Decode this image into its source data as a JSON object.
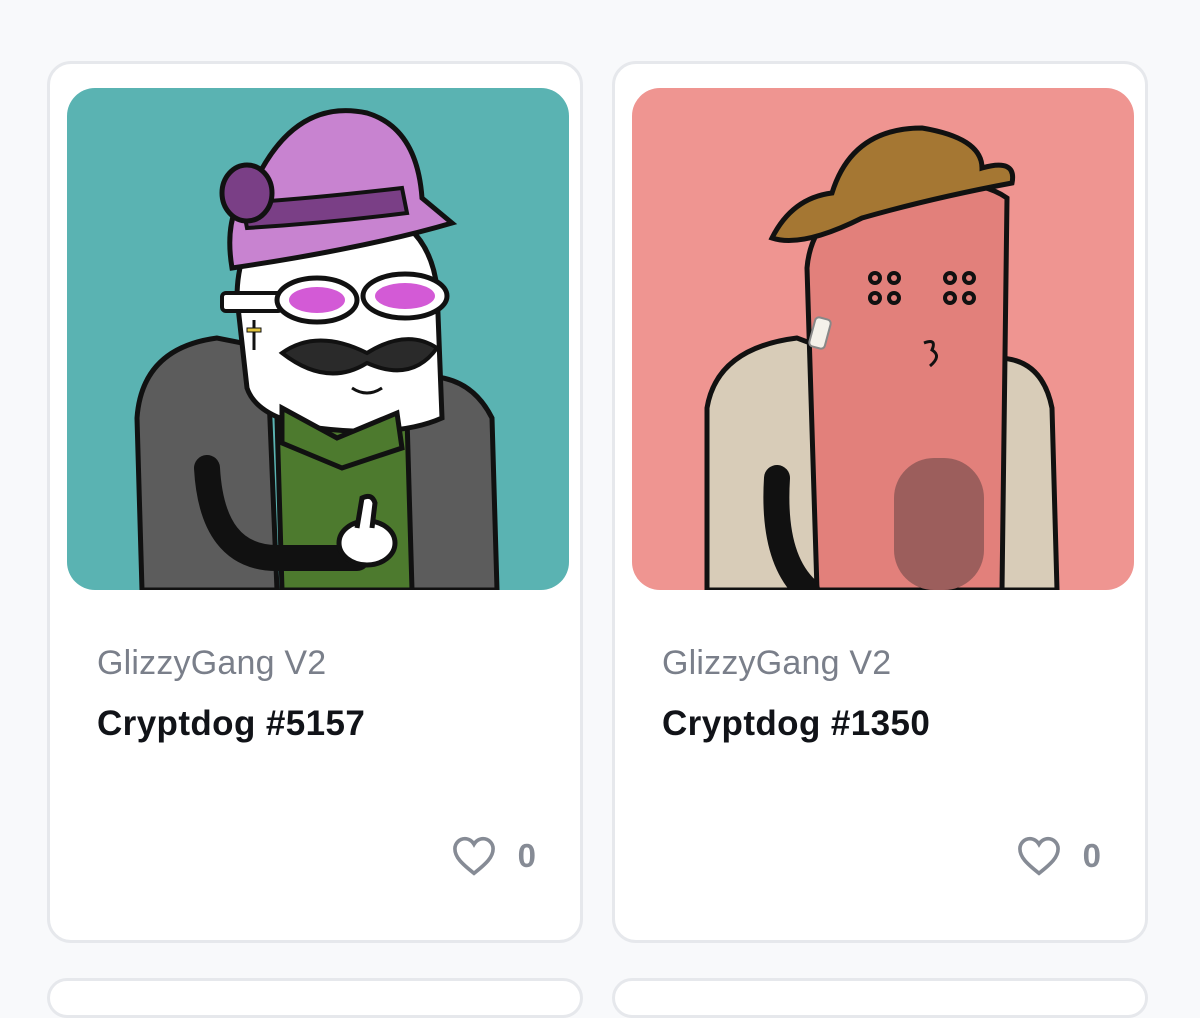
{
  "cards": [
    {
      "collection": "GlizzyGang V2",
      "name": "Cryptdog #5157",
      "likes": "0",
      "art_background": "#5ab3b2"
    },
    {
      "collection": "GlizzyGang V2",
      "name": "Cryptdog #1350",
      "likes": "0",
      "art_background": "#ef9591"
    }
  ],
  "icons": {
    "like": "heart-outline-icon"
  }
}
